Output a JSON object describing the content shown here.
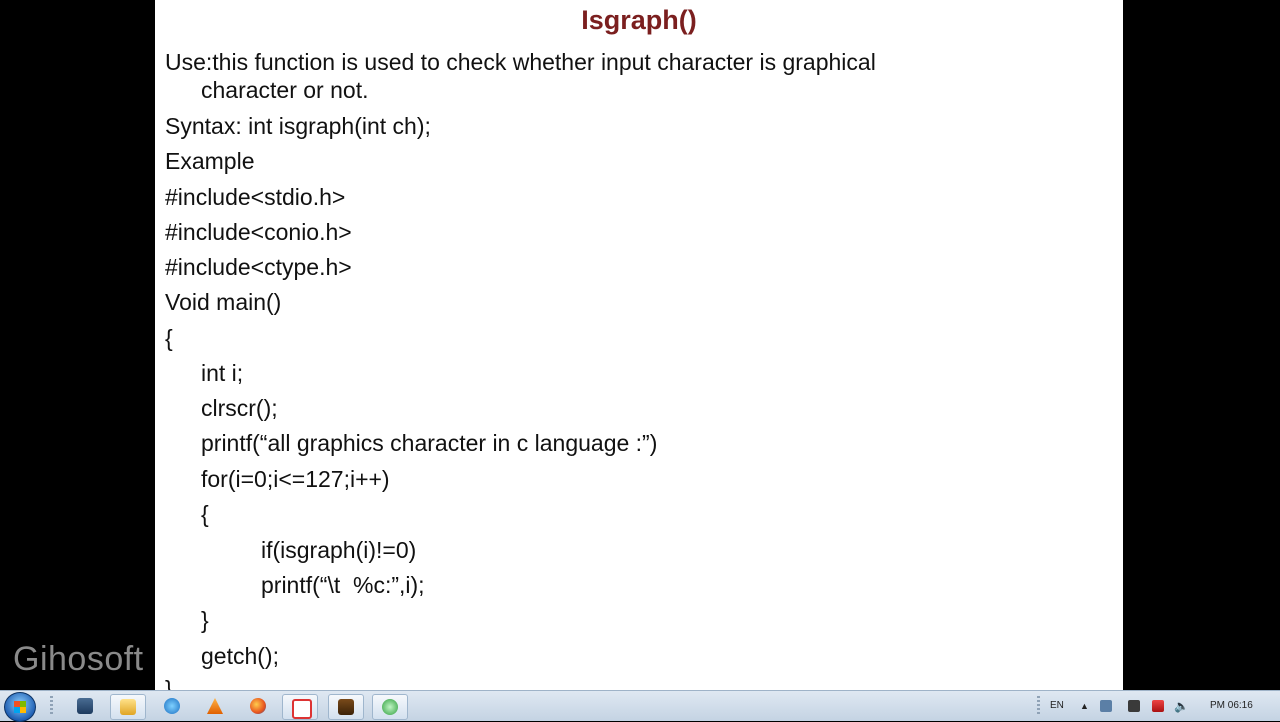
{
  "slide": {
    "title": "Isgraph()",
    "lines": [
      {
        "text": "Use:this function is used to check whether input character is graphical",
        "indent": 0
      },
      {
        "text": "character or not.",
        "indent": 1
      },
      {
        "text": "Syntax: int isgraph(int ch);",
        "indent": 0
      },
      {
        "text": "Example",
        "indent": 0
      },
      {
        "text": "#include<stdio.h>",
        "indent": 0
      },
      {
        "text": "#include<conio.h>",
        "indent": 0
      },
      {
        "text": "#include<ctype.h>",
        "indent": 0
      },
      {
        "text": "Void main()",
        "indent": 0
      },
      {
        "text": "{",
        "indent": 0
      },
      {
        "text": "int i;",
        "indent": 1
      },
      {
        "text": "clrscr();",
        "indent": 1
      },
      {
        "text": "printf(“all graphics character in c language :”)",
        "indent": 1
      },
      {
        "text": "for(i=0;i<=127;i++)",
        "indent": 1
      },
      {
        "text": "{",
        "indent": 1
      },
      {
        "text": "if(isgraph(i)!=0)",
        "indent": 2
      },
      {
        "text": "printf(“\\t  %c:”,i);",
        "indent": 2
      },
      {
        "text": "}",
        "indent": 1
      },
      {
        "text": "getch();",
        "indent": 1
      },
      {
        "text": "}",
        "indent": 0
      }
    ]
  },
  "watermark": "Gihosoft",
  "taskbar": {
    "icons": [
      "start-orb",
      "remote-icon",
      "folder-icon",
      "vlc-icon",
      "firefox-icon",
      "app-icon",
      "dosbox-icon",
      "media-icon"
    ],
    "tray": {
      "language": "EN",
      "clock": "PM 06:16"
    }
  },
  "colors": {
    "title": "#7b1f1f",
    "slide_bg": "#ffffff",
    "taskbar": "#c4d3e3"
  }
}
